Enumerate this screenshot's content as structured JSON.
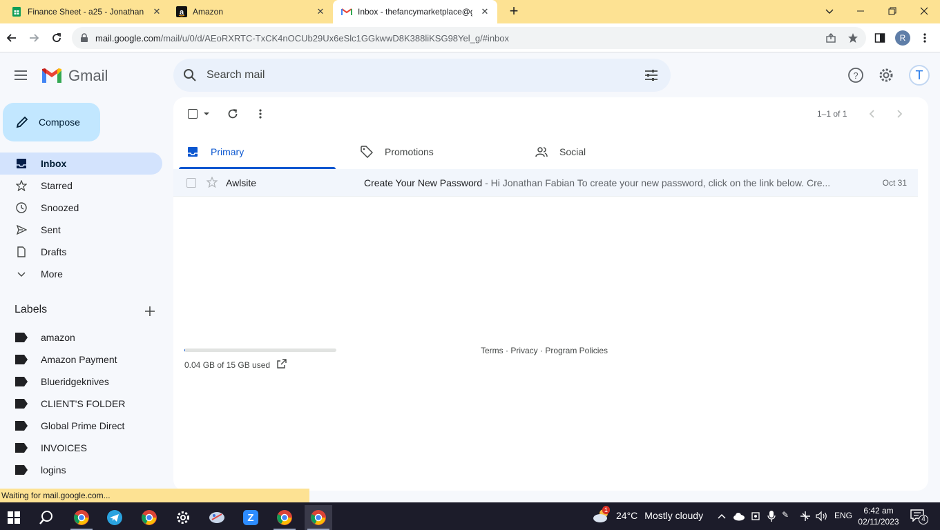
{
  "browser": {
    "tabs": [
      {
        "title": "Finance Sheet - a25 - Jonathan F",
        "favicon": "sheets-icon",
        "active": false
      },
      {
        "title": "Amazon",
        "favicon": "amazon-icon",
        "active": false
      },
      {
        "title": "Inbox - thefancymarketplace@g",
        "favicon": "gmail-icon",
        "active": true
      }
    ],
    "url_host": "mail.google.com",
    "url_path": "/mail/u/0/d/AEoRXRTC-TxCK4nOCUb29Ux6eSlc1GGkwwD8K388liKSG98Yel_g/#inbox",
    "profile_initial": "R"
  },
  "gmail": {
    "brand": "Gmail",
    "search_placeholder": "Search mail",
    "account_initial": "T",
    "compose_label": "Compose",
    "nav": [
      {
        "label": "Inbox",
        "icon": "inbox-icon",
        "active": true
      },
      {
        "label": "Starred",
        "icon": "star-icon"
      },
      {
        "label": "Snoozed",
        "icon": "clock-icon"
      },
      {
        "label": "Sent",
        "icon": "send-icon"
      },
      {
        "label": "Drafts",
        "icon": "draft-icon"
      },
      {
        "label": "More",
        "icon": "chevron-down-icon"
      }
    ],
    "labels_heading": "Labels",
    "labels": [
      "amazon",
      "Amazon Payment",
      "Blueridgeknives",
      "CLIENT'S FOLDER",
      "Global Prime Direct",
      "INVOICES",
      "logins"
    ],
    "pager": "1–1 of 1",
    "categories": [
      {
        "label": "Primary",
        "icon": "inbox-icon",
        "active": true
      },
      {
        "label": "Promotions",
        "icon": "tag-icon"
      },
      {
        "label": "Social",
        "icon": "people-icon"
      }
    ],
    "emails": [
      {
        "sender": "Awlsite",
        "subject": "Create Your New Password",
        "snippet": " - Hi Jonathan Fabian To create your new password, click on the link below. Cre...",
        "date": "Oct 31"
      }
    ],
    "storage_text": "0.04 GB of 15 GB used",
    "storage_fraction": 0.003,
    "footer": "Terms · Privacy · Program Policies"
  },
  "status_text": "Waiting for mail.google.com...",
  "taskbar": {
    "temperature": "24°C",
    "weather": "Mostly cloudy",
    "weather_badge": "1",
    "language": "ENG",
    "time": "6:42 am",
    "date": "02/11/2023",
    "notification_count": "4"
  },
  "colors": {
    "tabstrip": "#fde293",
    "active_nav": "#d3e3fd",
    "compose": "#c2e7ff",
    "accent": "#0b57d0"
  }
}
